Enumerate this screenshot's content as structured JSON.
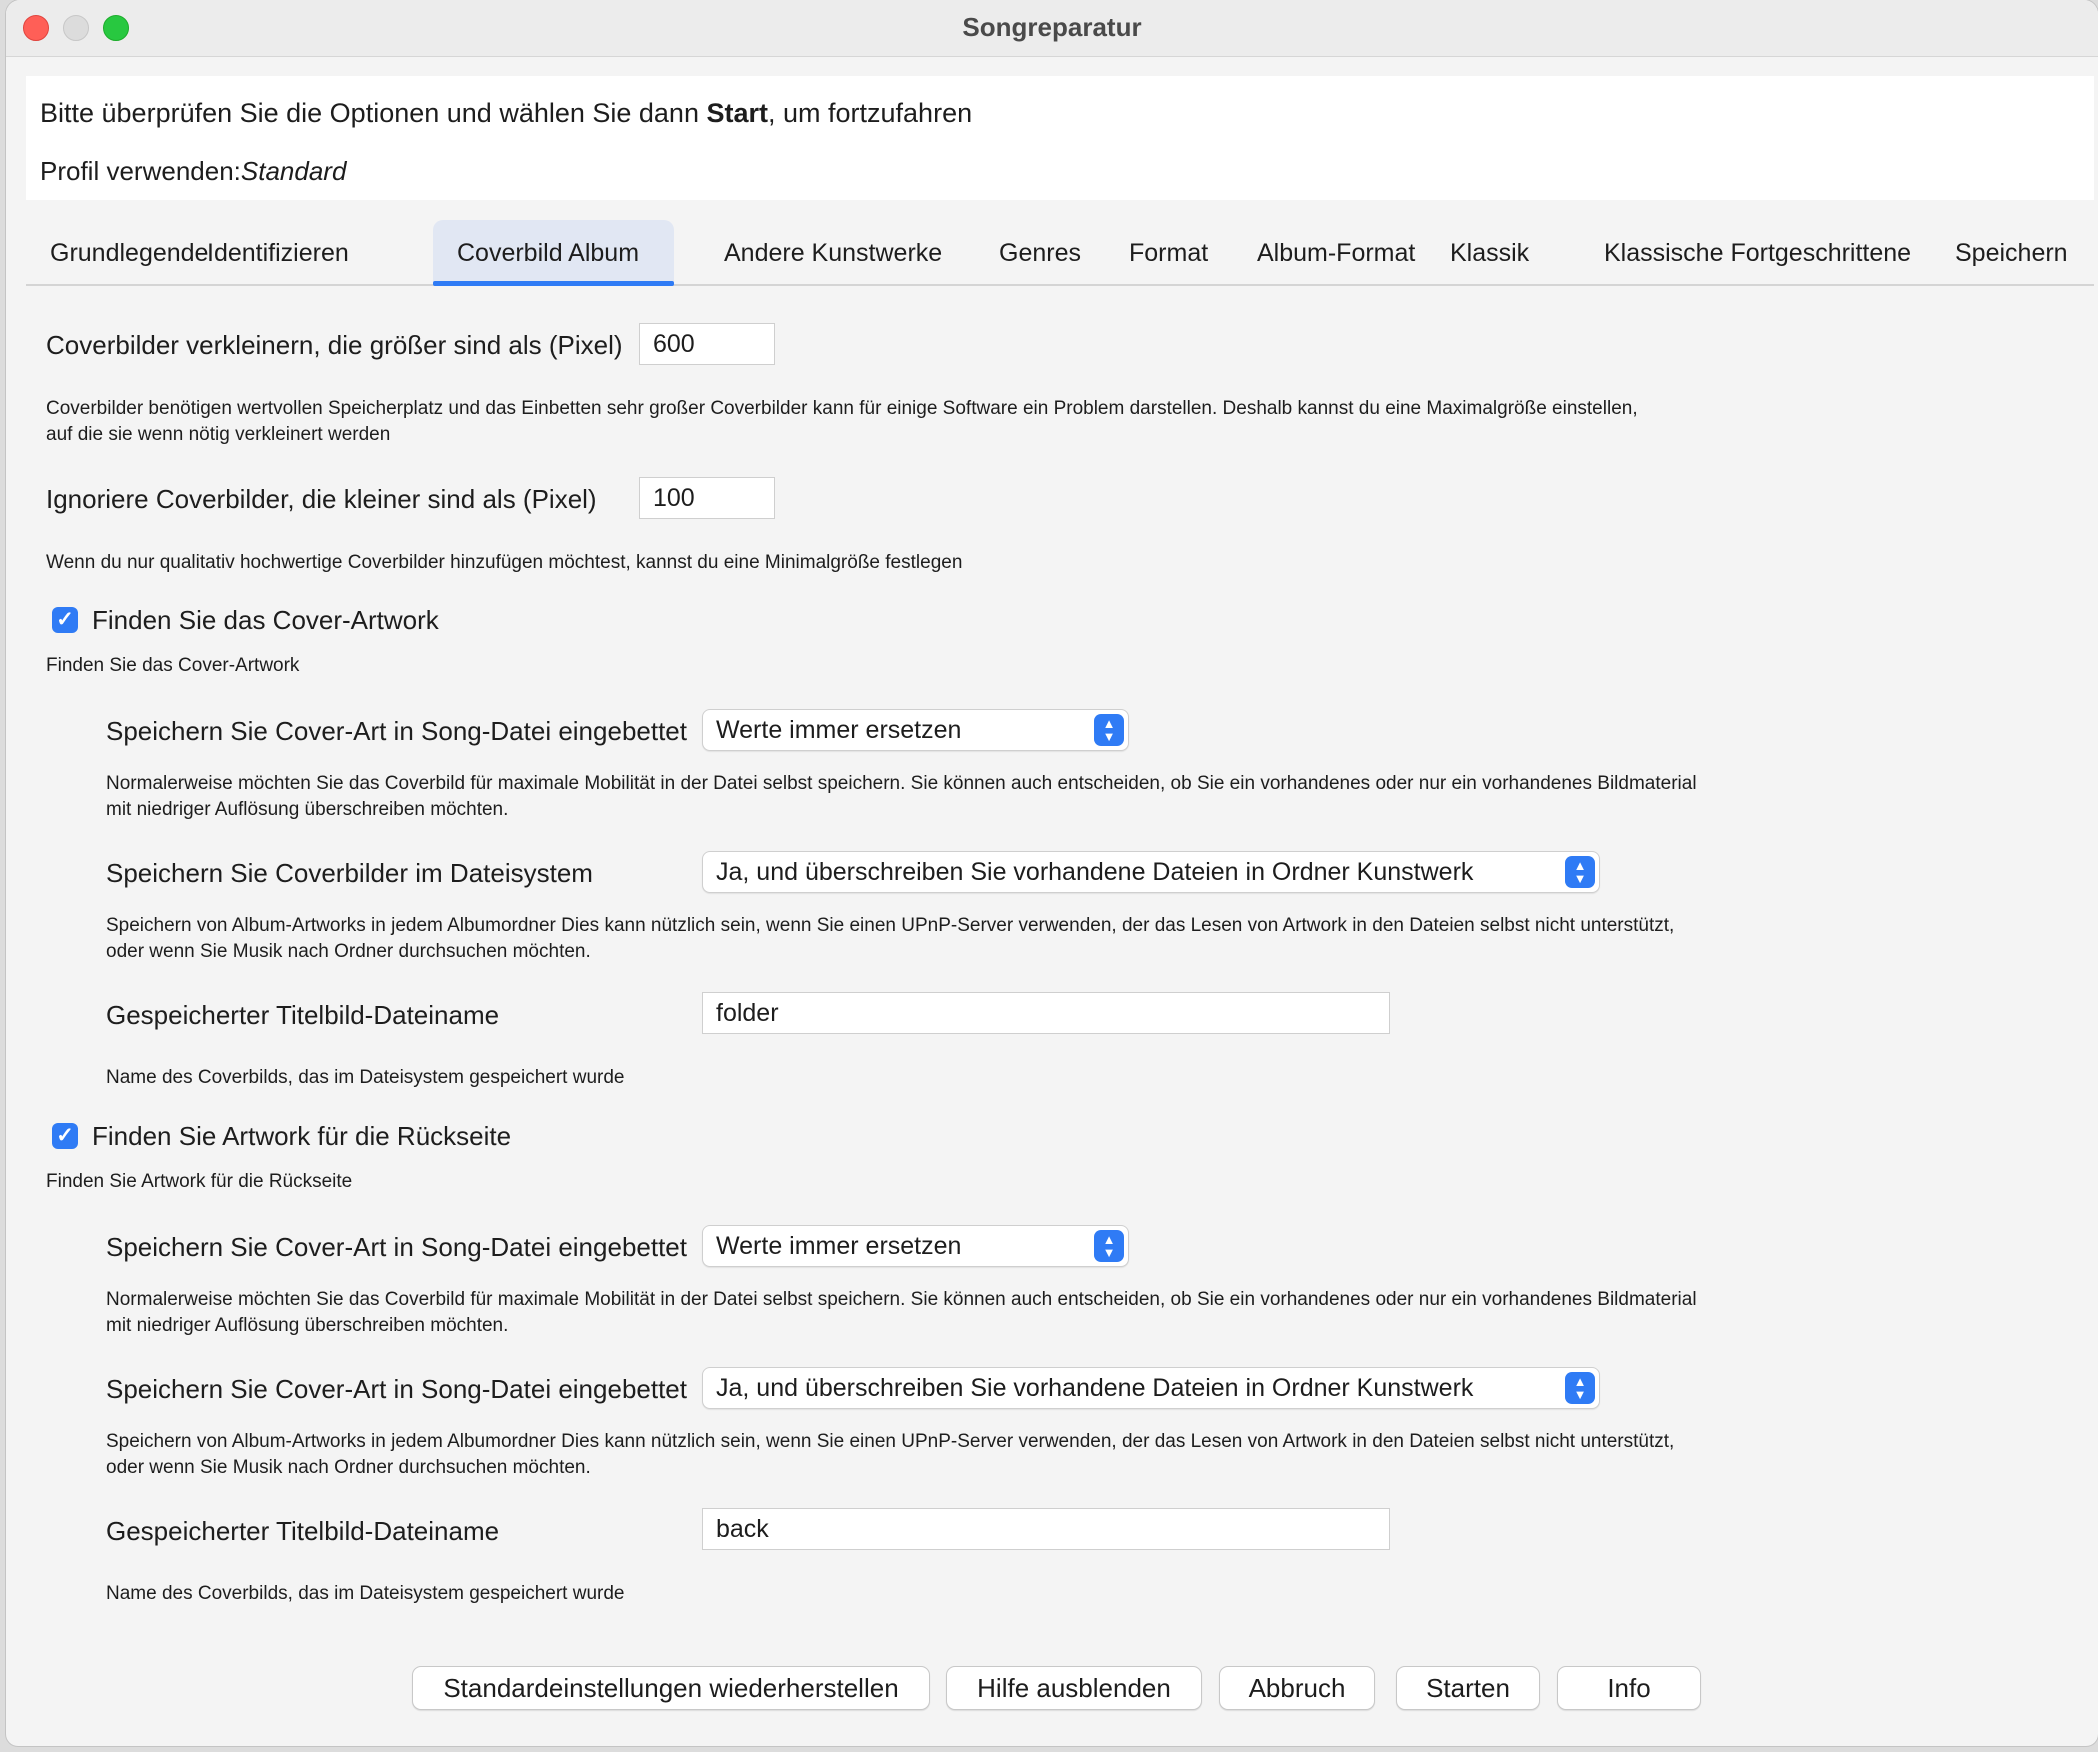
{
  "window": {
    "title": "Songreparatur"
  },
  "intro": {
    "line1_before": "Bitte überprüfen Sie die Optionen und wählen Sie dann ",
    "line1_bold": "Start",
    "line1_after": ", um fortzufahren",
    "profile_label": "Profil verwenden:",
    "profile_value": "Standard"
  },
  "tabs": [
    {
      "label": "Grundlegende"
    },
    {
      "label": "Identifizieren"
    },
    {
      "label": "Coverbild Album",
      "active": true
    },
    {
      "label": "Andere Kunstwerke"
    },
    {
      "label": "Genres"
    },
    {
      "label": "Format"
    },
    {
      "label": "Album-Format"
    },
    {
      "label": "Klassik"
    },
    {
      "label": "Klassische Fortgeschrittene"
    },
    {
      "label": "Speichern"
    }
  ],
  "resize": {
    "label": "Coverbilder verkleinern, die größer sind als (Pixel)",
    "value": "600",
    "help": "Coverbilder benötigen wertvollen Speicherplatz und das Einbetten sehr großer Coverbilder kann für einige Software ein Problem darstellen. Deshalb kannst du eine Maximalgröße einstellen,",
    "help2": "auf die sie wenn nötig verkleinert werden"
  },
  "ignore": {
    "label": "Ignoriere Coverbilder, die kleiner sind als (Pixel)",
    "value": "100",
    "help": "Wenn du nur qualitativ hochwertige Coverbilder hinzufügen möchtest, kannst du eine Minimalgröße festlegen"
  },
  "front": {
    "checkbox_label": "Finden Sie das Cover-Artwork",
    "checked": true,
    "help": "Finden Sie das Cover-Artwork",
    "embed_label": "Speichern Sie Cover-Art in Song-Datei eingebettet",
    "embed_value": "Werte immer ersetzen",
    "embed_help": "Normalerweise möchten Sie das Coverbild für maximale Mobilität in der Datei selbst speichern. Sie können auch entscheiden, ob Sie ein vorhandenes oder nur ein vorhandenes Bildmaterial",
    "embed_help2": "mit niedriger Auflösung überschreiben möchten.",
    "fs_label": "Speichern Sie Coverbilder im Dateisystem",
    "fs_value": "Ja, und überschreiben Sie vorhandene Dateien in Ordner Kunstwerk",
    "fs_help": "Speichern von Album-Artworks in jedem Albumordner Dies kann nützlich sein, wenn Sie einen UPnP-Server verwenden, der das Lesen von Artwork in den Dateien selbst nicht unterstützt,",
    "fs_help2": "oder wenn Sie Musik nach Ordner durchsuchen möchten.",
    "filename_label": "Gespeicherter Titelbild-Dateiname",
    "filename_value": "folder",
    "filename_help": "Name des Coverbilds, das im Dateisystem gespeichert wurde"
  },
  "back": {
    "checkbox_label": "Finden Sie Artwork für die Rückseite",
    "checked": true,
    "help": "Finden Sie Artwork für die Rückseite",
    "embed_label": "Speichern Sie Cover-Art in Song-Datei eingebettet",
    "embed_value": "Werte immer ersetzen",
    "embed_help": "Normalerweise möchten Sie das Coverbild für maximale Mobilität in der Datei selbst speichern. Sie können auch entscheiden, ob Sie ein vorhandenes oder nur ein vorhandenes Bildmaterial",
    "embed_help2": "mit niedriger Auflösung überschreiben möchten.",
    "fs_label": "Speichern Sie Cover-Art in Song-Datei eingebettet",
    "fs_value": "Ja, und überschreiben Sie vorhandene Dateien in Ordner Kunstwerk",
    "fs_help": "Speichern von Album-Artworks in jedem Albumordner Dies kann nützlich sein, wenn Sie einen UPnP-Server verwenden, der das Lesen von Artwork in den Dateien selbst nicht unterstützt,",
    "fs_help2": "oder wenn Sie Musik nach Ordner durchsuchen möchten.",
    "filename_label": "Gespeicherter Titelbild-Dateiname",
    "filename_value": "back",
    "filename_help": "Name des Coverbilds, das im Dateisystem gespeichert wurde"
  },
  "buttons": {
    "restore": "Standardeinstellungen wiederherstellen",
    "hide_help": "Hilfe ausblenden",
    "cancel": "Abbruch",
    "start": "Starten",
    "info": "Info"
  },
  "icons": {
    "checkmark": "✓",
    "select_up": "▲",
    "select_down": "▼"
  },
  "colors": {
    "accent": "#2f7bf5",
    "close": "#ff5f57",
    "minimize": "#dcdcdc",
    "maximize": "#28c840"
  }
}
